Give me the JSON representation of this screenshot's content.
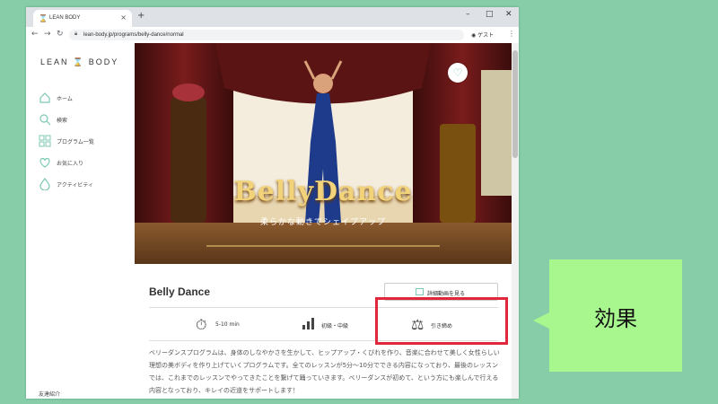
{
  "browser": {
    "tab_title": "LEAN BODY",
    "tab_close": "×",
    "new_tab": "+",
    "window_controls": [
      "–",
      "□",
      "✕"
    ],
    "url": "lean-body.jp/programs/belly-dance/normal",
    "profile_label": "ゲスト"
  },
  "sidebar": {
    "logo": "LEAN ⌛ BODY",
    "items": [
      {
        "label": "ホーム",
        "icon": "home-icon"
      },
      {
        "label": "検索",
        "icon": "search-icon"
      },
      {
        "label": "プログラム一覧",
        "icon": "grid-icon"
      },
      {
        "label": "お気に入り",
        "icon": "heart-icon"
      },
      {
        "label": "アクティビティ",
        "icon": "drop-icon"
      }
    ],
    "footer_link": "友達紹介"
  },
  "hero": {
    "title": "BellyDance",
    "subtitle": "柔らかな動きでシェイプアップ"
  },
  "program": {
    "title": "Belly Dance",
    "video_button": "詳細動画を見る",
    "stats": [
      {
        "label": "5-10 min",
        "icon": "stopwatch-icon"
      },
      {
        "label": "初級・中級",
        "icon": "level-bars-icon"
      },
      {
        "label": "引き締め",
        "icon": "kettlebell-icon"
      }
    ],
    "description": "ベリーダンスプログラムは、身体のしなやかさを生かして、ヒップアップ・くびれを作り、音楽に合わせて美しく女性らしい理想の美ボディを作り上げていくプログラムです。全てのレッスンが5分〜10分でできる内容になっており、最後のレッスンでは、これまでのレッスンでやってきたことを繋げて踊っていきます。ベリーダンスが初めて、という方にも楽しんで行える内容となっており、キレイの近道をサポートします！"
  },
  "annotation": {
    "label": "効果",
    "highlight_color": "#e0283c",
    "callout_color": "#a8f78e"
  },
  "colors": {
    "background": "#86cda8",
    "accent": "#7cc8b4"
  }
}
